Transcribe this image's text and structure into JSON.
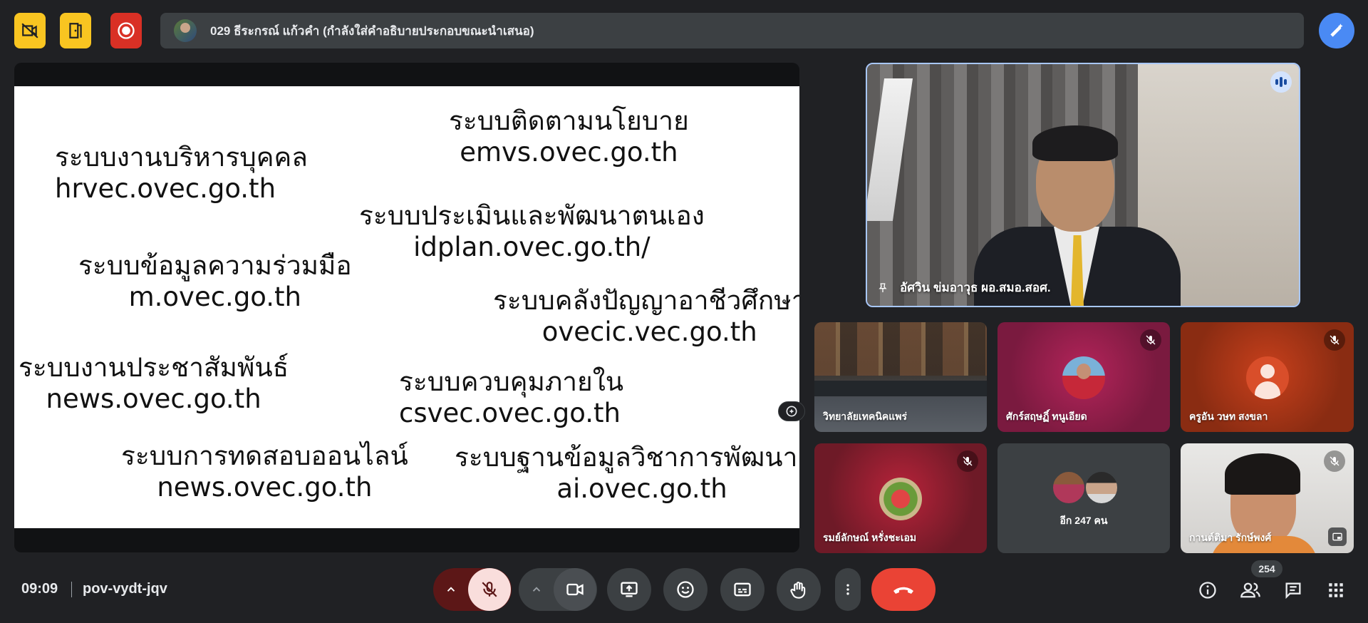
{
  "top_bar": {
    "presenter_label": "029 ธีระกรณ์ แก้วคำ (กำลังใส่คำอธิบายประกอบขณะนำเสนอ)"
  },
  "slide": {
    "items": [
      {
        "title": "ระบบงานบริหารบุคคล",
        "url": "hrvec.ovec.go.th"
      },
      {
        "title": "ระบบติดตามนโยบาย",
        "url": "emvs.ovec.go.th"
      },
      {
        "title": "ระบบประเมินและพัฒนาตนเอง",
        "url": "idplan.ovec.go.th/"
      },
      {
        "title": "ระบบข้อมูลความร่วมมือ",
        "url": "m.ovec.go.th"
      },
      {
        "title": "ระบบคลังปัญญาอาชีวศึกษา",
        "url": "ovecic.vec.go.th"
      },
      {
        "title": "ระบบงานประชาสัมพันธ์",
        "url": "news.ovec.go.th"
      },
      {
        "title": "ระบบควบคุมภายใน",
        "url": "csvec.ovec.go.th"
      },
      {
        "title": "ระบบการทดสอบออนไลน์",
        "url": "news.ovec.go.th"
      },
      {
        "title": "ระบบฐานข้อมูลวิชาการพัฒนาครู",
        "url": "ai.ovec.go.th"
      }
    ]
  },
  "participants": {
    "main": {
      "name": "อัศวิน ข่มอาวุธ ผอ.สมอ.สอศ.",
      "speaking": true,
      "pinned": true
    },
    "tiles": [
      {
        "name": "วิทยาลัยเทคนิคแพร่",
        "muted": false
      },
      {
        "name": "ศักร์สฤษฏิ์ ทนูเอียด",
        "muted": true
      },
      {
        "name": "ครูอัน วษท สงขลา",
        "muted": true
      },
      {
        "name": "รมย์ลักษณ์ หรั่งชะเอม",
        "muted": true
      },
      {
        "name": "อีก 247 คน",
        "muted": false
      },
      {
        "name": "กานต์ติมา รักษ์พงศ์",
        "muted": true
      }
    ]
  },
  "bottom_bar": {
    "time": "09:09",
    "meeting_code": "pov-vydt-jqv",
    "participant_count": "254"
  },
  "colors": {
    "background": "#202124",
    "end_call": "#ea4335",
    "mic_muted_bg": "#f9dedc",
    "highlight_border": "#a8c7fa",
    "accent_blue": "#4a8af4",
    "warning_yellow": "#f9c521"
  }
}
